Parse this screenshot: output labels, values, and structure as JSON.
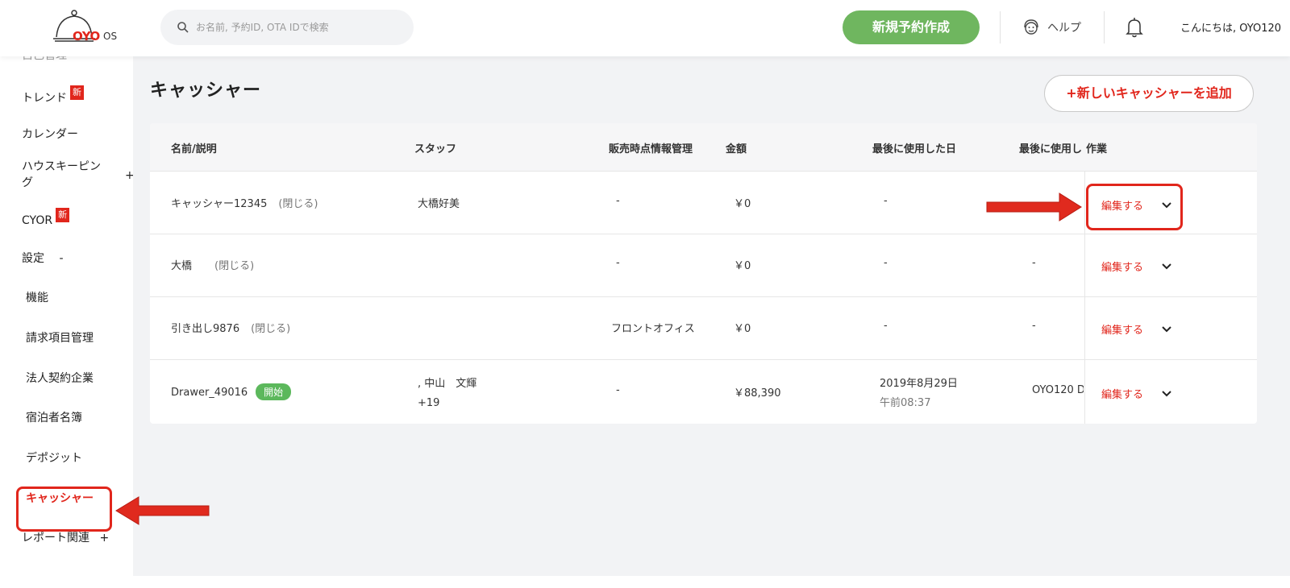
{
  "header": {
    "logo_brand": "OYO",
    "logo_suffix": "OS",
    "search_placeholder": "お名前, 予約ID, OTA IDで検索",
    "new_booking_label": "新規予約作成",
    "help_label": "ヘルプ",
    "greeting": "こんにちは, OYO120"
  },
  "sidebar": {
    "partial_top": "自己管理",
    "items": [
      {
        "label": "トレンド",
        "badge": "新"
      },
      {
        "label": "カレンダー"
      },
      {
        "label": "ハウスキーピン",
        "label2": "グ",
        "toggle": "+"
      },
      {
        "label": "CYOR",
        "badge": "新"
      },
      {
        "label": "設定",
        "toggle": "-"
      },
      {
        "label": "機能"
      },
      {
        "label": "請求項目管理"
      },
      {
        "label": "法人契約企業"
      },
      {
        "label": "宿泊者名簿"
      },
      {
        "label": "デポジット"
      },
      {
        "label": "キャッシャー"
      },
      {
        "label": "レポート関連",
        "toggle": "+"
      }
    ]
  },
  "main": {
    "title": "キャッシャー",
    "add_button": "+新しいキャッシャーを追加",
    "table": {
      "headers": [
        "名前/説明",
        "スタッフ",
        "販売時点情報管理",
        "金額",
        "最後に使用した日",
        "最後に使用し",
        "作業"
      ],
      "rows": [
        {
          "name": "キャッシャー12345",
          "status": "(閉じる)",
          "staff": "大橋好美",
          "staff2": "",
          "pos": "-",
          "amount": "￥0",
          "last_date": "-",
          "last_date2": "",
          "last_used": "",
          "action": "編集する"
        },
        {
          "name": "大橋",
          "status": "(閉じる)",
          "staff": "",
          "staff2": "",
          "pos": "-",
          "amount": "￥0",
          "last_date": "-",
          "last_date2": "",
          "last_used": "-",
          "action": "編集する"
        },
        {
          "name": "引き出し9876",
          "status": "(閉じる)",
          "staff": "",
          "staff2": "",
          "pos": "フロントオフィス",
          "amount": "￥0",
          "last_date": "-",
          "last_date2": "",
          "last_used": "-",
          "action": "編集する"
        },
        {
          "name": "Drawer_49016",
          "status_badge": "開始",
          "staff": ", 中山　文輝",
          "staff2": "+19",
          "pos": "-",
          "amount": "￥88,390",
          "last_date": "2019年8月29日",
          "last_date2": "午前08:37",
          "last_used": "OYO120 D",
          "action": "編集する"
        }
      ]
    }
  },
  "colors": {
    "accent_red": "#e1261c",
    "brand_green": "#6fb65f",
    "bg_gray": "#f2f3f5"
  }
}
